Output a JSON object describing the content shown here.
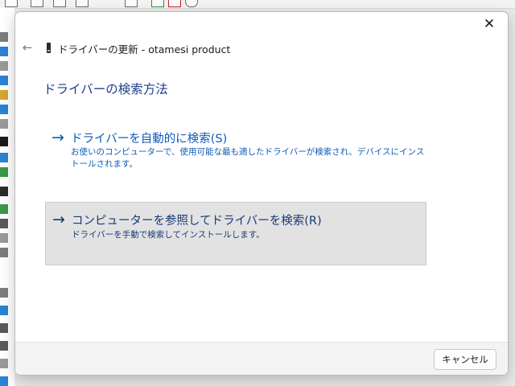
{
  "dialog": {
    "close_glyph": "✕",
    "back_glyph": "←",
    "title": "ドライバーの更新 - otamesi product",
    "heading": "ドライバーの検索方法",
    "options": [
      {
        "arrow": "→",
        "title": "ドライバーを自動的に検索(S)",
        "description": "お使いのコンピューターで、使用可能な最も適したドライバーが検索され、デバイスにインストールされます。"
      },
      {
        "arrow": "→",
        "title": "コンピューターを参照してドライバーを検索(R)",
        "description": "ドライバーを手動で検索してインストールします。"
      }
    ],
    "cancel_label": "キャンセル"
  },
  "colors": {
    "link_blue": "#0d5bb8",
    "heading_navy": "#1e3f8e",
    "selected_option_bg": "#e2e2e2"
  }
}
